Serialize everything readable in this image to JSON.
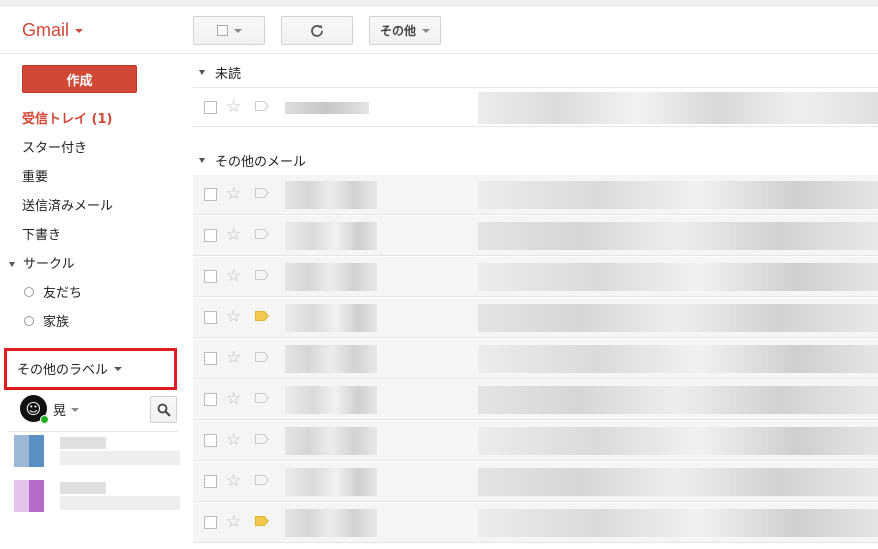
{
  "brand": {
    "name": "Gmail"
  },
  "toolbar": {
    "more_label": "その他"
  },
  "sidebar": {
    "compose_label": "作成",
    "items": [
      {
        "label": "受信トレイ (1)",
        "active": true
      },
      {
        "label": "スター付き"
      },
      {
        "label": "重要"
      },
      {
        "label": "送信済みメール"
      },
      {
        "label": "下書き"
      }
    ],
    "circles": {
      "label": "サークル",
      "items": [
        {
          "label": "友だち"
        },
        {
          "label": "家族"
        }
      ]
    },
    "more_labels": "その他のラベル"
  },
  "chat": {
    "user_name": "晃",
    "avatar_glyph": "☺"
  },
  "sections": {
    "unread": "未読",
    "other": "その他のメール"
  },
  "colors": {
    "accent": "#d14836",
    "highlight": "#e01b24",
    "important_marker": "#f2c94c",
    "online": "#22b022"
  },
  "icons": [
    "select-all-checkbox-icon",
    "refresh-icon",
    "star-icon",
    "importance-marker-icon",
    "search-icon"
  ],
  "rows": {
    "unread": [
      {
        "important": false
      }
    ],
    "other": [
      {
        "important": false
      },
      {
        "important": false
      },
      {
        "important": false
      },
      {
        "important": true
      },
      {
        "important": false
      },
      {
        "important": false
      },
      {
        "important": false
      },
      {
        "important": false
      },
      {
        "important": true
      }
    ]
  }
}
